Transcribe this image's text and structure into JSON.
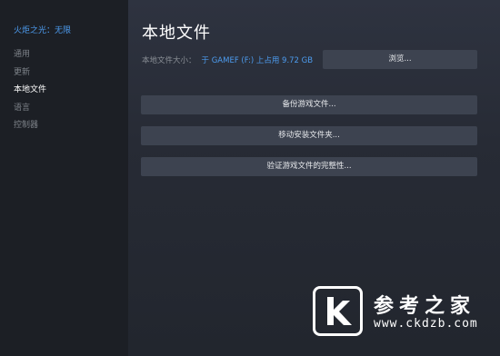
{
  "sidebar": {
    "game_title": "火炬之光：无限",
    "items": [
      {
        "label": "通用",
        "active": false
      },
      {
        "label": "更新",
        "active": false
      },
      {
        "label": "本地文件",
        "active": true
      },
      {
        "label": "语言",
        "active": false
      },
      {
        "label": "控制器",
        "active": false
      }
    ]
  },
  "main": {
    "title": "本地文件",
    "size_label": "本地文件大小：",
    "size_value": "于 GAMEF (F:) 上占用 9.72 GB",
    "browse_label": "浏览...",
    "backup_label": "备份游戏文件...",
    "move_label": "移动安装文件夹...",
    "verify_label": "验证游戏文件的完整性..."
  },
  "watermark": {
    "site_name": "参考之家",
    "url": "www.ckdzb.com",
    "logo_letter": "K"
  },
  "colors": {
    "accent": "#4d9cf0",
    "sidebar_bg": "#1c1f25",
    "button_bg": "#3d4350"
  }
}
